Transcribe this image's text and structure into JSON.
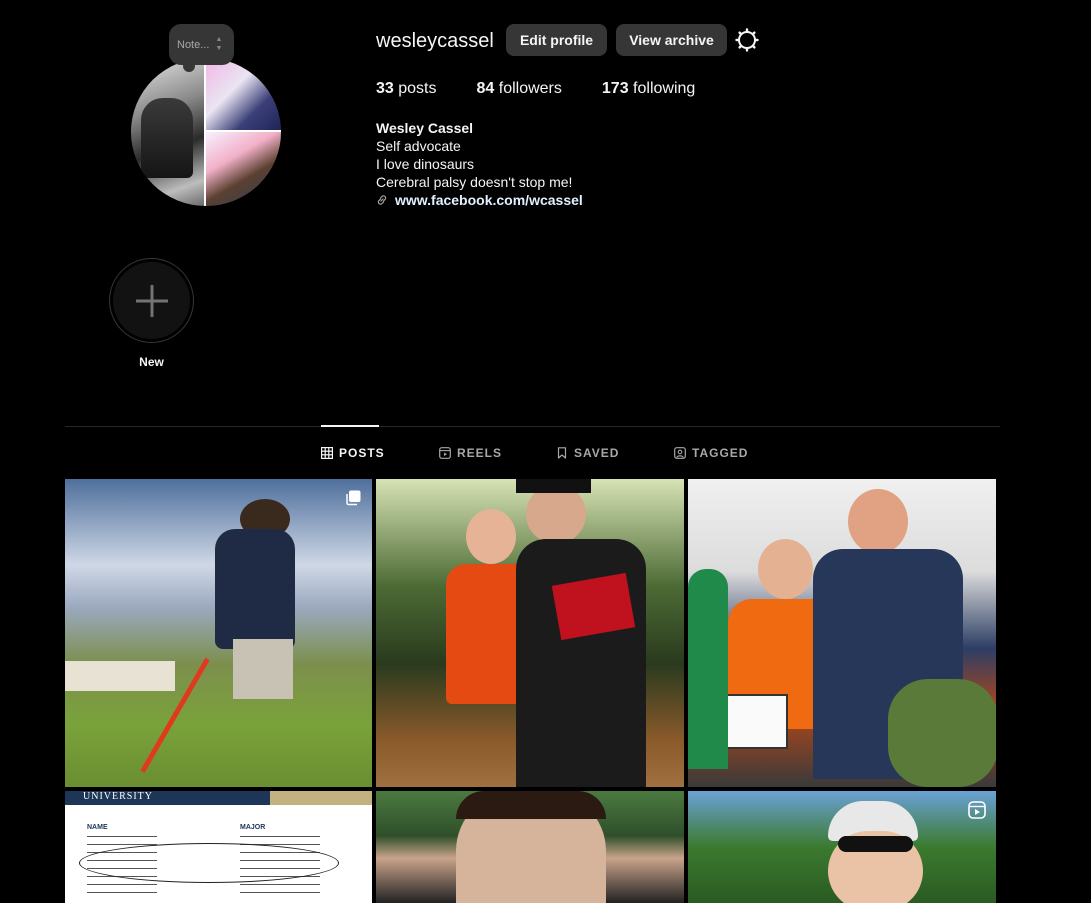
{
  "profile": {
    "username": "wesleycassel",
    "note_placeholder": "Note...",
    "edit_profile_label": "Edit profile",
    "view_archive_label": "View archive",
    "stats": [
      {
        "num": "33",
        "label": "posts"
      },
      {
        "num": "84",
        "label": "followers"
      },
      {
        "num": "173",
        "label": "following"
      }
    ],
    "bio": {
      "name": "Wesley Cassel",
      "lines": [
        "Self advocate",
        "I love dinosaurs",
        "Cerebral palsy doesn't stop me!"
      ],
      "link": "www.facebook.com/wcassel"
    }
  },
  "highlight": {
    "label": "New"
  },
  "tabs": [
    {
      "label": "POSTS",
      "icon": "grid-icon",
      "active": true
    },
    {
      "label": "REELS",
      "icon": "reels-icon",
      "active": false
    },
    {
      "label": "SAVED",
      "icon": "bookmark-icon",
      "active": false
    },
    {
      "label": "TAGGED",
      "icon": "tagged-icon",
      "active": false
    }
  ],
  "posts": [
    {
      "type": "carousel",
      "icon": "carousel-icon"
    },
    {
      "type": "photo"
    },
    {
      "type": "photo"
    },
    {
      "type": "photo",
      "doc": {
        "university": "UNIVERSITY",
        "col1_title": "NAME",
        "col2_title": "MAJOR"
      }
    },
    {
      "type": "photo"
    },
    {
      "type": "reel",
      "icon": "reel-icon"
    }
  ],
  "colors": {
    "background": "#000000",
    "button": "#363636",
    "text": "#f5f5f5",
    "secondary_text": "#a8a8a8",
    "link": "#e0f1ff"
  }
}
